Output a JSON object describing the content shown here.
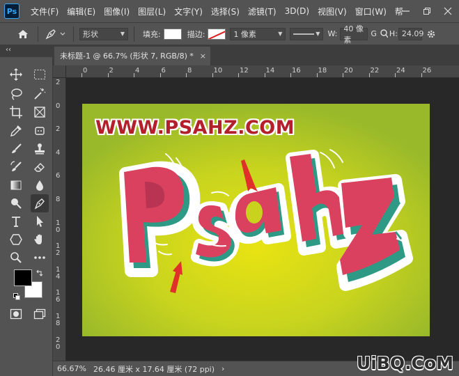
{
  "app": {
    "logo": "Ps"
  },
  "menu": {
    "items": [
      "文件(F)",
      "编辑(E)",
      "图像(I)",
      "图层(L)",
      "文字(Y)",
      "选择(S)",
      "滤镜(T)",
      "3D(D)",
      "视图(V)",
      "窗口(W)",
      "帮"
    ],
    "window_controls": [
      "minimize-icon",
      "restore-icon",
      "close-icon"
    ]
  },
  "options": {
    "mode_value": "形状",
    "fill_label": "填充:",
    "stroke_label": "描边:",
    "stroke_width_value": "1 像素",
    "width_label": "W:",
    "width_value": "40 像素",
    "go_label": "G",
    "height_label": "H:",
    "height_value": "24.09"
  },
  "panel": {
    "collapse_glyph": "‹‹"
  },
  "tools": [
    "move-icon",
    "marquee-icon",
    "lasso-icon",
    "magic-wand-icon",
    "crop-icon",
    "frame-icon",
    "eyedropper-icon",
    "patch-icon",
    "brush-icon",
    "stamp-icon",
    "history-brush-icon",
    "eraser-icon",
    "gradient-icon",
    "blur-drop-icon",
    "dodge-icon",
    "pen-icon",
    "type-icon",
    "path-select-icon",
    "shape-icon",
    "hand-icon",
    "zoom-icon",
    "more-icon"
  ],
  "document": {
    "tab_title": "未标题-1 @ 66.7% (形状 7, RGB/8) *",
    "close_glyph": "×"
  },
  "ruler": {
    "top_labels": [
      "0",
      "2",
      "4",
      "6",
      "8",
      "10",
      "12",
      "14",
      "16",
      "18",
      "20",
      "22",
      "24",
      "26"
    ],
    "left_labels": [
      "2",
      "0",
      "2",
      "4",
      "6",
      "8",
      "1 0",
      "1 2",
      "1 4",
      "1 6",
      "1 8",
      "2 0"
    ]
  },
  "artwork": {
    "url_text": "WWW.PSAHZ.COM",
    "title_letters": [
      "P",
      "s",
      "a",
      "h",
      "Z"
    ],
    "colors": {
      "bg_center": "#e8e312",
      "bg_edge": "#99b92a",
      "letter_fill": "#d9415e",
      "letter_side": "#2e9a85",
      "outline": "#ffffff",
      "arrow": "#e0302a",
      "url_text": "#b3202c"
    }
  },
  "status": {
    "zoom": "66.67%",
    "doc_size": "26.46 厘米 x 17.64 厘米 (72 ppi)",
    "more_glyph": "›"
  },
  "site_watermark": "UiBQ.CoM"
}
